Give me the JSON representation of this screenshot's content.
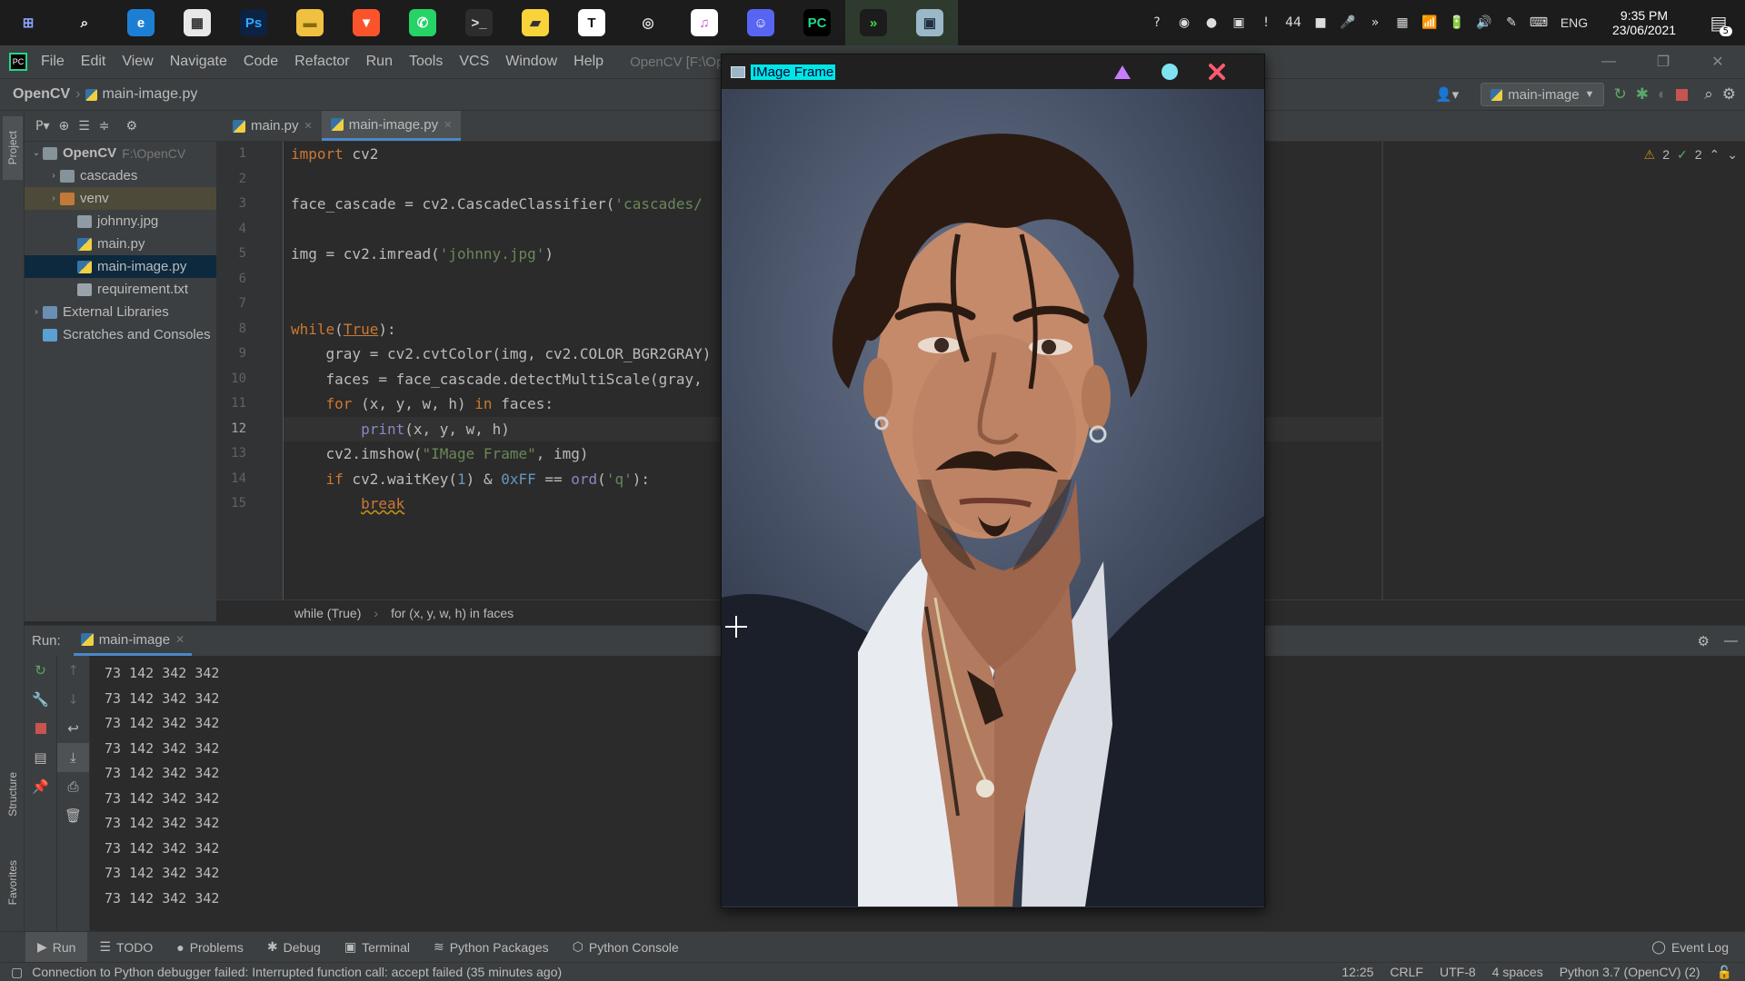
{
  "taskbar": {
    "apps": [
      {
        "name": "start-icon",
        "glyph": "⊞",
        "bg": "#1c1c1c",
        "color": "#8aa3ff"
      },
      {
        "name": "search-icon",
        "glyph": "⌕",
        "bg": "#1c1c1c",
        "color": "#ffffff"
      },
      {
        "name": "edge-icon",
        "glyph": "e",
        "bg": "#1d7fd4",
        "color": "#ffffff"
      },
      {
        "name": "store-icon",
        "glyph": "▦",
        "bg": "#e8e8e8",
        "color": "#333333"
      },
      {
        "name": "photoshop-icon",
        "glyph": "Ps",
        "bg": "#0b2242",
        "color": "#31a8ff"
      },
      {
        "name": "file-explorer-icon",
        "glyph": "▬",
        "bg": "#f0c040",
        "color": "#8a6a10"
      },
      {
        "name": "brave-icon",
        "glyph": "▼",
        "bg": "#fb542b",
        "color": "#ffffff"
      },
      {
        "name": "whatsapp-icon",
        "glyph": "✆",
        "bg": "#25d366",
        "color": "#ffffff"
      },
      {
        "name": "terminal-icon",
        "glyph": ">_",
        "bg": "#2d2d2d",
        "color": "#dddddd"
      },
      {
        "name": "sticky-notes-icon",
        "glyph": "▰",
        "bg": "#f8d33a",
        "color": "#333333"
      },
      {
        "name": "typora-icon",
        "glyph": "T",
        "bg": "#ffffff",
        "color": "#111111"
      },
      {
        "name": "obs-icon",
        "glyph": "◎",
        "bg": "#1c1c1c",
        "color": "#dddddd"
      },
      {
        "name": "itunes-icon",
        "glyph": "♫",
        "bg": "#ffffff",
        "color": "#d94ac8"
      },
      {
        "name": "discord-like-icon",
        "glyph": "☺",
        "bg": "#5865f2",
        "color": "#ffffff"
      },
      {
        "name": "pycharm-icon",
        "glyph": "PC",
        "bg": "#000000",
        "color": "#21d789"
      },
      {
        "name": "powerautomate-icon",
        "glyph": "»",
        "bg": "#1c1c1c",
        "color": "#3ddc3d"
      },
      {
        "name": "image-window-icon",
        "glyph": "▣",
        "bg": "#9ab8c8",
        "color": "#203040"
      }
    ],
    "tray": [
      "?",
      "◉",
      "●",
      "▣",
      "!",
      "44",
      "■",
      "🎤",
      "»",
      "▦",
      "📶",
      "🔋",
      "🔊",
      "✎",
      "⌨"
    ],
    "lang": "ENG",
    "time": "9:35 PM",
    "date": "23/06/2021",
    "notif_count": "5"
  },
  "menu": {
    "items": [
      "File",
      "Edit",
      "View",
      "Navigate",
      "Code",
      "Refactor",
      "Run",
      "Tools",
      "VCS",
      "Window",
      "Help"
    ],
    "window_title": "OpenCV [F:\\OpenCV] -"
  },
  "nav": {
    "project": "OpenCV",
    "file": "main-image.py",
    "run_config": "main-image"
  },
  "project": {
    "head_label": "P▾",
    "root": "OpenCV",
    "root_path": "F:\\OpenCV",
    "items": [
      {
        "label": "cascades",
        "kind": "folder",
        "indent": 2,
        "arrow": "›"
      },
      {
        "label": "venv",
        "kind": "folder-orange",
        "indent": 2,
        "arrow": "›"
      },
      {
        "label": "johnny.jpg",
        "kind": "image",
        "indent": 3,
        "arrow": ""
      },
      {
        "label": "main.py",
        "kind": "py",
        "indent": 3,
        "arrow": ""
      },
      {
        "label": "main-image.py",
        "kind": "py",
        "indent": 3,
        "arrow": ""
      },
      {
        "label": "requirement.txt",
        "kind": "txt",
        "indent": 3,
        "arrow": ""
      },
      {
        "label": "External Libraries",
        "kind": "lib",
        "indent": 1,
        "arrow": "›"
      },
      {
        "label": "Scratches and Consoles",
        "kind": "scratch",
        "indent": 1,
        "arrow": ""
      }
    ]
  },
  "tabs": [
    {
      "label": "main.py",
      "active": false
    },
    {
      "label": "main-image.py",
      "active": true
    }
  ],
  "editor": {
    "line_numbers": [
      "1",
      "2",
      "3",
      "4",
      "5",
      "6",
      "7",
      "8",
      "9",
      "10",
      "11",
      "12",
      "13",
      "14",
      "15"
    ],
    "inspections": {
      "warnings": "2",
      "ok": "2"
    },
    "breadcrumb": [
      "while (True)",
      "for (x, y, w, h) in faces"
    ]
  },
  "run": {
    "label": "Run:",
    "config": "main-image",
    "output": [
      "73 142 342 342",
      "73 142 342 342",
      "73 142 342 342",
      "73 142 342 342",
      "73 142 342 342",
      "73 142 342 342",
      "73 142 342 342",
      "73 142 342 342",
      "73 142 342 342",
      "73 142 342 342"
    ]
  },
  "toolwindows": [
    "Run",
    "TODO",
    "Problems",
    "Debug",
    "Terminal",
    "Python Packages",
    "Python Console"
  ],
  "event_log": "Event Log",
  "side_labels": {
    "project": "Project",
    "structure": "Structure",
    "favorites": "Favorites"
  },
  "status": {
    "message": "Connection to Python debugger failed: Interrupted function call: accept failed (35 minutes ago)",
    "position": "12:25",
    "line_sep": "CRLF",
    "encoding": "UTF-8",
    "indent": "4 spaces",
    "interpreter": "Python 3.7 (OpenCV) (2)"
  },
  "image_window": {
    "title": "IMage Frame",
    "title_highlight": "#00e5e5"
  },
  "colors": {
    "accent": "#4a88c7",
    "keyword": "#cc7832",
    "string": "#6a8759",
    "number": "#6897bb"
  }
}
